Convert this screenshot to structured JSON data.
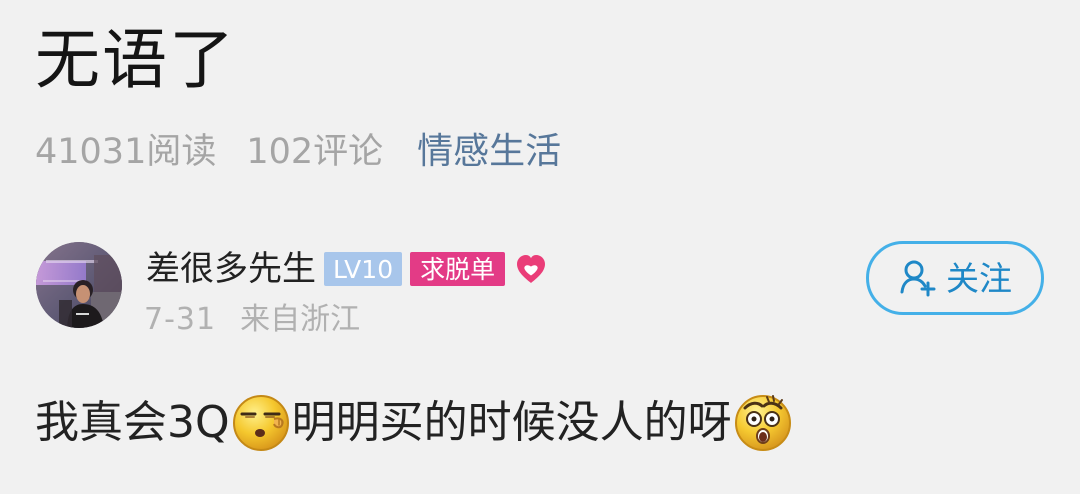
{
  "post": {
    "title": "无语了",
    "read_count": "41031阅读",
    "comment_count": "102评论",
    "category": "情感生活"
  },
  "author": {
    "name": "差很多先生",
    "level": "LV10",
    "tag": "求脱单",
    "time": "7-31",
    "location": "来自浙江",
    "follow_label": "关注"
  },
  "content": {
    "before_first_emoji": "我真会3Q",
    "between_emojis": "明明买的时候没人的呀"
  },
  "icons": {
    "heart": "heart-icon",
    "follow": "add-user-icon",
    "first_emoji": "sleepy-face-emoji-icon",
    "second_emoji": "shocked-face-emoji-icon"
  },
  "colors": {
    "background": "#f1f1f1",
    "category": "#57779a",
    "level_badge": "#a8c6eb",
    "tag_badge": "#e33b86",
    "follow": "#44b0e8"
  }
}
